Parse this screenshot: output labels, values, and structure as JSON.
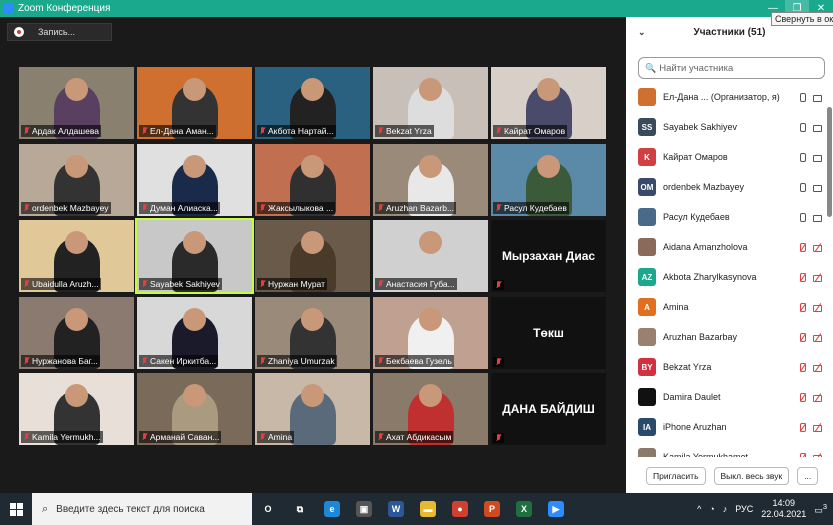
{
  "window": {
    "title": "Zoom Конференция",
    "tooltip": "Свернуть в окно"
  },
  "toolbar": {
    "record_label": "Запись..."
  },
  "gallery": [
    {
      "name": "Ардак Алдашева",
      "bg": "#8a8070",
      "shirt": "#5a4060"
    },
    {
      "name": "Ел-Дана Аман...",
      "bg": "#d07030",
      "shirt": "#333"
    },
    {
      "name": "Акбота Нартай...",
      "bg": "#2a6080",
      "shirt": "#222"
    },
    {
      "name": "Bekzat Yrza",
      "bg": "#c8c0b8",
      "shirt": "#ddd"
    },
    {
      "name": "Кайрат Омаров",
      "bg": "#d8d0c8",
      "shirt": "#4a4a6a"
    },
    {
      "name": "ordenbek Mazbayey",
      "bg": "#b8a898",
      "shirt": "#333"
    },
    {
      "name": "Думан Алиаска...",
      "bg": "#e0e0e0",
      "shirt": "#1a2a4a"
    },
    {
      "name": "Жаксылыкова ...",
      "bg": "#c07050",
      "shirt": "#303030"
    },
    {
      "name": "Aruzhan Bazarb...",
      "bg": "#9a8a7a",
      "shirt": "#e8e8e8"
    },
    {
      "name": "Расул Кудебаев",
      "bg": "#5a8aa8",
      "shirt": "#3a5a3a"
    },
    {
      "name": "Ubaidulla Aruzh...",
      "bg": "#e0c898",
      "shirt": "#222"
    },
    {
      "name": "Sayabek Sakhiyev",
      "bg": "#c8c8c8",
      "shirt": "#2a2a2a",
      "active": true
    },
    {
      "name": "Нуржан Мурат",
      "bg": "#6a5a4a",
      "shirt": "#4a3a2a"
    },
    {
      "name": "Анастасия Губа...",
      "bg": "#d0d0d0",
      "shirt": "#d0d0d0"
    },
    {
      "name": "",
      "big": "Мырзахан Диас",
      "bg": "#111"
    },
    {
      "name": "Нуржанова Баг...",
      "bg": "#8a7a70",
      "shirt": "#222"
    },
    {
      "name": "Сакен Иркитба...",
      "bg": "#d8d8d8",
      "shirt": "#1a1a2a"
    },
    {
      "name": "Zhaniya Umurzak",
      "bg": "#9a8a7a",
      "shirt": "#333"
    },
    {
      "name": "Бекбаева Гузель",
      "bg": "#c0a090",
      "shirt": "#f0f0f0"
    },
    {
      "name": "",
      "big": "Төкш",
      "bg": "#111"
    },
    {
      "name": "Kamila Yermukh...",
      "bg": "#e8e0d8",
      "shirt": "#333"
    },
    {
      "name": "Арманай Саван...",
      "bg": "#7a6a5a",
      "shirt": "#aa9a80"
    },
    {
      "name": "Amina",
      "bg": "#c8b8a8",
      "shirt": "#5a6a7a"
    },
    {
      "name": "Ахат Абдикасым",
      "bg": "#8a7a6a",
      "shirt": "#c03030"
    },
    {
      "name": "",
      "big": "ДАНА БАЙДИШ",
      "bg": "#111"
    }
  ],
  "panel": {
    "title": "Участники (51)",
    "search_placeholder": "Найти участника",
    "participants": [
      {
        "initials": "",
        "name": "Ел-Дана ...  (Организатор, я)",
        "color": "#d07030",
        "mic": "normal",
        "cam": "normal"
      },
      {
        "initials": "SS",
        "name": "Sayabek Sakhiyev",
        "color": "#3a4a5a",
        "mic": "normal",
        "cam": "normal"
      },
      {
        "initials": "K",
        "name": "Кайрат Омаров",
        "color": "#d04040",
        "mic": "normal",
        "cam": "normal"
      },
      {
        "initials": "OM",
        "name": "ordenbek Mazbayey",
        "color": "#3a4a6a",
        "mic": "normal",
        "cam": "normal"
      },
      {
        "initials": "",
        "name": "Расул Кудебаев",
        "color": "#4a6a8a",
        "mic": "normal",
        "cam": "normal"
      },
      {
        "initials": "",
        "name": "Aidana Amanzholova",
        "color": "#8a6a5a",
        "mic": "muted",
        "cam": "off"
      },
      {
        "initials": "AZ",
        "name": "Akbota Zharylkasynova",
        "color": "#1aa98c",
        "mic": "muted",
        "cam": "off"
      },
      {
        "initials": "A",
        "name": "Amina",
        "color": "#e07020",
        "mic": "muted",
        "cam": "off"
      },
      {
        "initials": "",
        "name": "Aruzhan Bazarbay",
        "color": "#9a8070",
        "mic": "muted",
        "cam": "off"
      },
      {
        "initials": "BY",
        "name": "Bekzat Yrza",
        "color": "#d03040",
        "mic": "muted",
        "cam": "off"
      },
      {
        "initials": "",
        "name": "Damira Daulet",
        "color": "#111",
        "mic": "muted",
        "cam": "off"
      },
      {
        "initials": "IA",
        "name": "iPhone Aruzhan",
        "color": "#2a4a6a",
        "mic": "muted",
        "cam": "off"
      },
      {
        "initials": "",
        "name": "Kamila Yermukhamet...",
        "color": "#8a7a6a",
        "mic": "muted",
        "cam": "off"
      }
    ],
    "invite_label": "Пригласить",
    "mute_all_label": "Выкл. весь звук",
    "more_label": "..."
  },
  "taskbar": {
    "search_placeholder": "Введите здесь текст для поиска",
    "apps": [
      {
        "name": "cortana",
        "glyph": "O",
        "color": "transparent"
      },
      {
        "name": "task-view",
        "glyph": "⧉",
        "color": "transparent"
      },
      {
        "name": "edge",
        "glyph": "e",
        "color": "#1e88d8"
      },
      {
        "name": "store",
        "glyph": "▣",
        "color": "#555"
      },
      {
        "name": "word",
        "glyph": "W",
        "color": "#2b579a"
      },
      {
        "name": "file-explorer",
        "glyph": "▬",
        "color": "#e8b830"
      },
      {
        "name": "chrome",
        "glyph": "●",
        "color": "#d04030"
      },
      {
        "name": "powerpoint",
        "glyph": "P",
        "color": "#d04a20"
      },
      {
        "name": "excel",
        "glyph": "X",
        "color": "#1e7040"
      },
      {
        "name": "zoom",
        "glyph": "▶",
        "color": "#2d8cff"
      }
    ],
    "lang": "РУС",
    "time": "14:09",
    "date": "22.04.2021",
    "notif_count": "3"
  }
}
